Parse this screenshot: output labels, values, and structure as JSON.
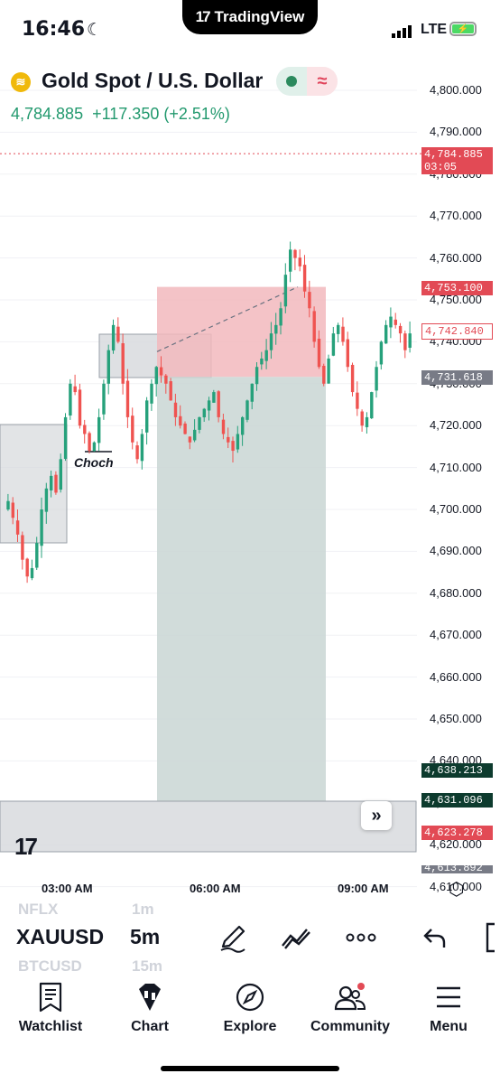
{
  "status_bar": {
    "time": "16:46",
    "network": "LTE",
    "notch_app": "TradingView"
  },
  "header": {
    "symbol_name": "Gold Spot / U.S. Dollar",
    "last_price": "4,784.885",
    "change": "+117.350 (+2.51%)",
    "session_icon": "open-market-dot",
    "delay_icon": "approx-icon"
  },
  "chart": {
    "price_axis": [
      "4,800.000",
      "4,790.000",
      "4,780.000",
      "4,770.000",
      "4,760.000",
      "4,750.000",
      "4,740.000",
      "4,730.000",
      "4,720.000",
      "4,710.000",
      "4,700.000",
      "4,690.000",
      "4,680.000",
      "4,670.000",
      "4,660.000",
      "4,650.000",
      "4,640.000",
      "4,630.000",
      "4,620.000",
      "4,610.000"
    ],
    "time_axis": [
      "03:00 AM",
      "06:00 AM",
      "09:00 AM"
    ],
    "price_tags": {
      "last": "4,784.885",
      "countdown": "03:05",
      "stop": "4,753.100",
      "current": "4,742.840",
      "entry": "4,731.618",
      "target1": "4,638.213",
      "target2": "4,631.096",
      "bottom_red": "4,623.278",
      "bottom_grey": "4,613.892"
    },
    "annotation_text": "Choch",
    "colors": {
      "up": "#26a17b",
      "down": "#ef5350",
      "stop_zone": "#f2b8bd",
      "target_zone": "#c9d6d3",
      "box": "#d6d8dc"
    },
    "chart_data": {
      "type": "candlestick",
      "symbol": "XAUUSD",
      "timeframe": "5m",
      "ylim": [
        4610,
        4805
      ],
      "position": {
        "entry": 4731.618,
        "stop": 4753.1,
        "target": 4631.096,
        "side": "short"
      },
      "close_path": [
        4700,
        4702,
        4698,
        4694,
        4688,
        4684,
        4686,
        4692,
        4700,
        4705,
        4708,
        4704,
        4712,
        4722,
        4730,
        4728,
        4720,
        4718,
        4714,
        4716,
        4722,
        4730,
        4738,
        4744,
        4740,
        4730,
        4722,
        4716,
        4712,
        4718,
        4726,
        4730,
        4734,
        4732,
        4730,
        4726,
        4722,
        4720,
        4718,
        4716,
        4719,
        4722,
        4724,
        4726,
        4728,
        4722,
        4718,
        4716,
        4714,
        4718,
        4722,
        4726,
        4730,
        4734,
        4736,
        4738,
        4742,
        4744,
        4748,
        4756,
        4762,
        4760,
        4758,
        4752,
        4748,
        4740,
        4734,
        4730,
        4736,
        4742,
        4744,
        4740,
        4734,
        4728,
        4724,
        4720,
        4722,
        4728,
        4734,
        4740,
        4744,
        4746,
        4744,
        4742,
        4738,
        4742
      ]
    }
  },
  "toolbar": {
    "symbol": "XAUUSD",
    "symbol_above": "NFLX",
    "symbol_below": "BTCUSD",
    "timeframe": "5m",
    "timeframe_above": "1m",
    "timeframe_below": "15m"
  },
  "nav": {
    "items": [
      {
        "label": "Watchlist",
        "icon": "watchlist-icon"
      },
      {
        "label": "Chart",
        "icon": "chart-icon"
      },
      {
        "label": "Explore",
        "icon": "compass-icon"
      },
      {
        "label": "Community",
        "icon": "community-icon"
      },
      {
        "label": "Menu",
        "icon": "menu-icon"
      }
    ]
  }
}
